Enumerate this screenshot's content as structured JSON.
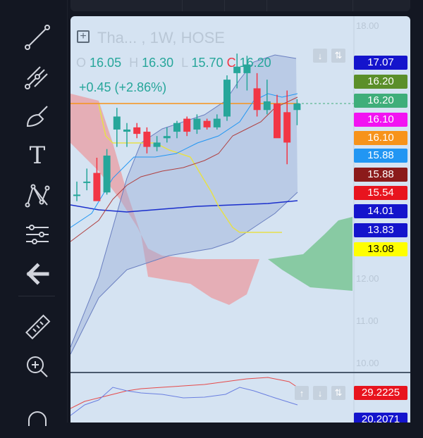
{
  "toolbar": {
    "tools": [
      {
        "name": "trend-line-icon"
      },
      {
        "name": "pitchfork-icon"
      },
      {
        "name": "brush-icon"
      },
      {
        "name": "text-icon",
        "glyph": "T"
      },
      {
        "name": "pattern-icon"
      },
      {
        "name": "measure-lines-icon"
      },
      {
        "name": "back-arrow-icon"
      },
      {
        "name": "ruler-icon"
      },
      {
        "name": "zoom-in-icon"
      },
      {
        "name": "magnet-icon"
      }
    ]
  },
  "legend": {
    "symbol": "Tha... , 1W, HOSE",
    "open_label": "O",
    "open": "16.05",
    "high_label": "H",
    "high": "16.30",
    "low_label": "L",
    "low": "15.70",
    "close_label": "C",
    "close": "16.20",
    "change": "+0.45 (+2.86%)"
  },
  "price_axis": {
    "ghost_labels": [
      "18.00",
      "12.00",
      "11.00",
      "10.00"
    ],
    "tags": [
      {
        "value": "17.07",
        "bg": "#1414cc",
        "fg": "#ffffff"
      },
      {
        "value": "16.20",
        "bg": "#5b8f2a",
        "fg": "#ffffff"
      },
      {
        "value": "16.20",
        "bg": "#3fae7a",
        "fg": "#ffffff"
      },
      {
        "value": "16.10",
        "bg": "#f213f2",
        "fg": "#ffffff"
      },
      {
        "value": "16.10",
        "bg": "#f7931a",
        "fg": "#ffffff"
      },
      {
        "value": "15.88",
        "bg": "#2196f3",
        "fg": "#ffffff"
      },
      {
        "value": "15.88",
        "bg": "#8b1a1a",
        "fg": "#ffffff"
      },
      {
        "value": "15.54",
        "bg": "#e8141e",
        "fg": "#ffffff"
      },
      {
        "value": "14.01",
        "bg": "#1414cc",
        "fg": "#ffffff"
      },
      {
        "value": "13.83",
        "bg": "#1414cc",
        "fg": "#ffffff"
      },
      {
        "value": "13.08",
        "bg": "#ffff00",
        "fg": "#000000"
      }
    ]
  },
  "oscillator": {
    "tags": [
      {
        "value": "29.2225",
        "bg": "#e8141e",
        "fg": "#ffffff"
      },
      {
        "value": "20.2071",
        "bg": "#1414cc",
        "fg": "#ffffff"
      }
    ]
  },
  "chart_data": {
    "type": "candlestick",
    "candles": [
      {
        "o": 14.1,
        "h": 14.4,
        "l": 13.95,
        "c": 14.1
      },
      {
        "o": 14.4,
        "h": 14.7,
        "l": 14.2,
        "c": 14.4
      },
      {
        "o": 14.6,
        "h": 14.95,
        "l": 14.1,
        "c": 13.95
      },
      {
        "o": 14.15,
        "h": 15.15,
        "l": 14.1,
        "c": 15.0
      },
      {
        "o": 15.6,
        "h": 16.1,
        "l": 15.2,
        "c": 15.9
      },
      {
        "o": 15.55,
        "h": 15.75,
        "l": 15.2,
        "c": 15.6
      },
      {
        "o": 15.65,
        "h": 15.75,
        "l": 15.4,
        "c": 15.5
      },
      {
        "o": 15.55,
        "h": 15.65,
        "l": 15.05,
        "c": 15.2
      },
      {
        "o": 15.2,
        "h": 15.45,
        "l": 15.1,
        "c": 15.3
      },
      {
        "o": 15.4,
        "h": 15.65,
        "l": 15.3,
        "c": 15.45
      },
      {
        "o": 15.55,
        "h": 15.8,
        "l": 15.4,
        "c": 15.75
      },
      {
        "o": 15.85,
        "h": 15.9,
        "l": 15.45,
        "c": 15.55
      },
      {
        "o": 15.6,
        "h": 15.95,
        "l": 15.5,
        "c": 15.85
      },
      {
        "o": 15.8,
        "h": 15.85,
        "l": 15.6,
        "c": 15.65
      },
      {
        "o": 15.65,
        "h": 15.95,
        "l": 15.6,
        "c": 15.85
      },
      {
        "o": 15.9,
        "h": 16.85,
        "l": 15.8,
        "c": 16.75
      },
      {
        "o": 16.9,
        "h": 17.35,
        "l": 16.55,
        "c": 17.05
      },
      {
        "o": 16.9,
        "h": 17.3,
        "l": 16.5,
        "c": 17.1
      },
      {
        "o": 16.55,
        "h": 16.9,
        "l": 15.9,
        "c": 16.05
      },
      {
        "o": 16.05,
        "h": 16.75,
        "l": 15.95,
        "c": 16.25
      },
      {
        "o": 16.2,
        "h": 16.4,
        "l": 15.95,
        "c": 15.4
      },
      {
        "o": 16.0,
        "h": 16.5,
        "l": 14.8,
        "c": 15.3
      },
      {
        "o": 16.05,
        "h": 16.3,
        "l": 15.7,
        "c": 16.2
      }
    ]
  }
}
